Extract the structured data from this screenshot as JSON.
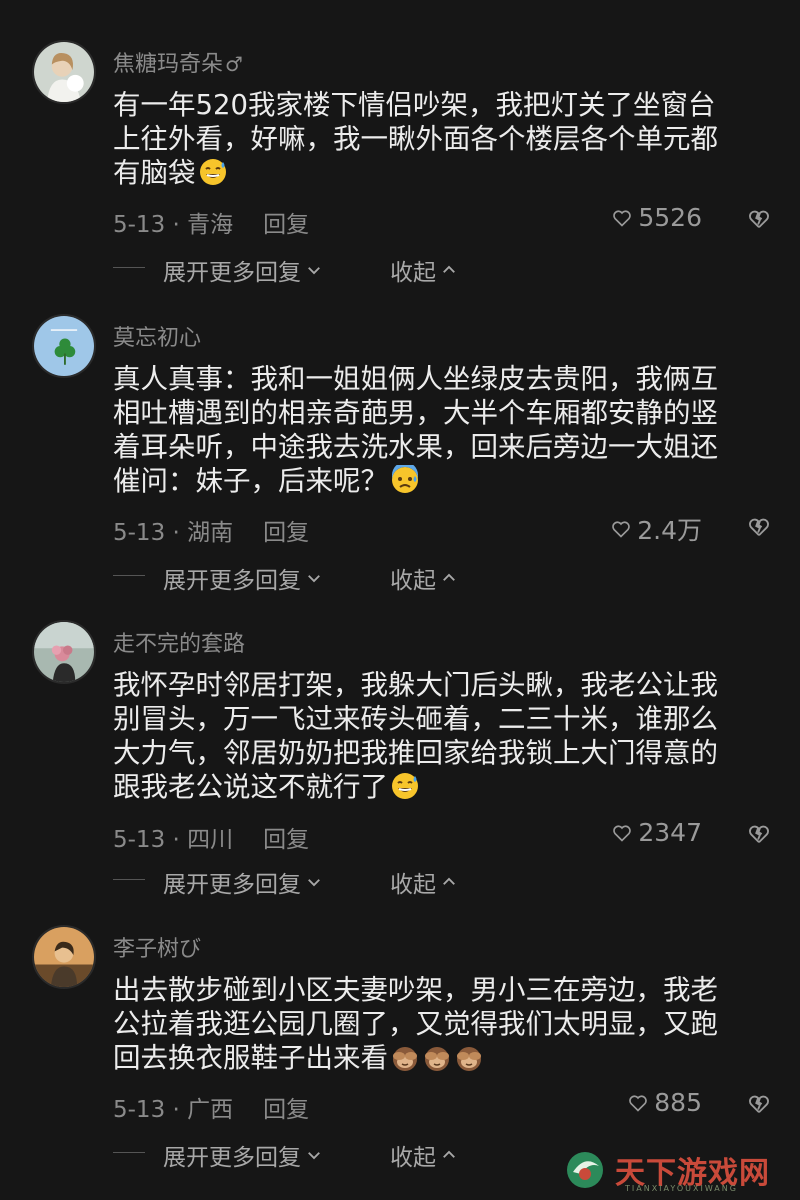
{
  "comments": [
    {
      "username": "焦糖玛奇朵",
      "gender_symbol": "♂",
      "lines": [
        "有一年520我家楼下情侣吵架，我把灯关了坐窗台",
        "上往外看，好嘛，我一瞅外面各个楼层各个单元都",
        "有脑袋"
      ],
      "emoji": "sweat-smile-emoji",
      "date_location": "5-13 · 青海",
      "reply_label": "回复",
      "likes": "5526",
      "expand_label": "展开更多回复",
      "collapse_label": "收起"
    },
    {
      "username": "莫忘初心",
      "lines": [
        "真人真事：我和一姐姐俩人坐绿皮去贵阳，我俩互",
        "相吐槽遇到的相亲奇葩男，大半个车厢都安静的竖",
        "着耳朵听，中途我去洗水果，回来后旁边一大姐还",
        "催问：妹子，后来呢？"
      ],
      "emoji": "anxious-sweat-emoji",
      "date_location": "5-13 · 湖南",
      "reply_label": "回复",
      "likes": "2.4万",
      "expand_label": "展开更多回复",
      "collapse_label": "收起"
    },
    {
      "username": "走不完的套路",
      "lines": [
        "我怀孕时邻居打架，我躲大门后头瞅，我老公让我",
        "别冒头，万一飞过来砖头砸着，二三十米，谁那么",
        "大力气，邻居奶奶把我推回家给我锁上大门得意的",
        "跟我老公说这不就行了"
      ],
      "emoji": "sweat-smile-emoji",
      "date_location": "5-13 · 四川",
      "reply_label": "回复",
      "likes": "2347",
      "expand_label": "展开更多回复",
      "collapse_label": "收起"
    },
    {
      "username": "李子树び",
      "lines": [
        "出去散步碰到小区夫妻吵架，男小三在旁边，我老",
        "公拉着我逛公园几圈了，又觉得我们太明显，又跑",
        "回去换衣服鞋子出来看"
      ],
      "emoji": "see-no-evil-monkey-emoji",
      "emoji_count": 3,
      "date_location": "5-13 · 广西",
      "reply_label": "回复",
      "likes": "885",
      "expand_label": "展开更多回复",
      "collapse_label": "收起"
    }
  ],
  "watermark": {
    "text": "天下游戏网",
    "subtext": "TIANXIAYOUXIWANG"
  },
  "colors": {
    "background": "#161616",
    "text": "#ececec",
    "secondary": "#8a8a8a",
    "watermark": "#c94a3a"
  }
}
